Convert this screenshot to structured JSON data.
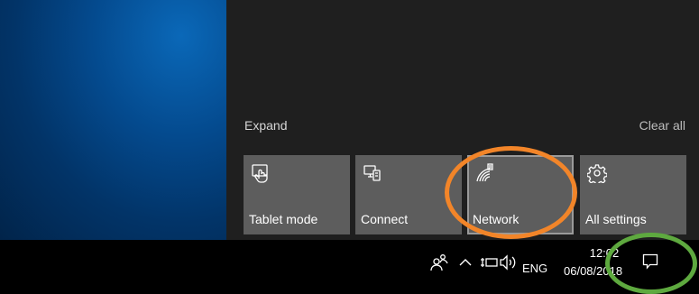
{
  "action_center": {
    "expand_label": "Expand",
    "clear_all_label": "Clear all",
    "tiles": [
      {
        "label": "Tablet mode",
        "icon": "tablet-mode-icon"
      },
      {
        "label": "Connect",
        "icon": "connect-icon"
      },
      {
        "label": "Network",
        "icon": "network-icon",
        "selected": true
      },
      {
        "label": "All settings",
        "icon": "gear-icon"
      }
    ]
  },
  "taskbar": {
    "language": "ENG",
    "time": "12:02",
    "date": "06/08/2018",
    "tray_icons": [
      "people-icon",
      "chevron-up-icon",
      "battery-icon",
      "volume-icon"
    ],
    "notifications_icon": "notification-icon"
  },
  "colors": {
    "highlight_network": "#f28529",
    "highlight_notifications": "#5ea93f",
    "tile_background": "#5d5d5d",
    "panel_background": "#1f1f1f"
  }
}
